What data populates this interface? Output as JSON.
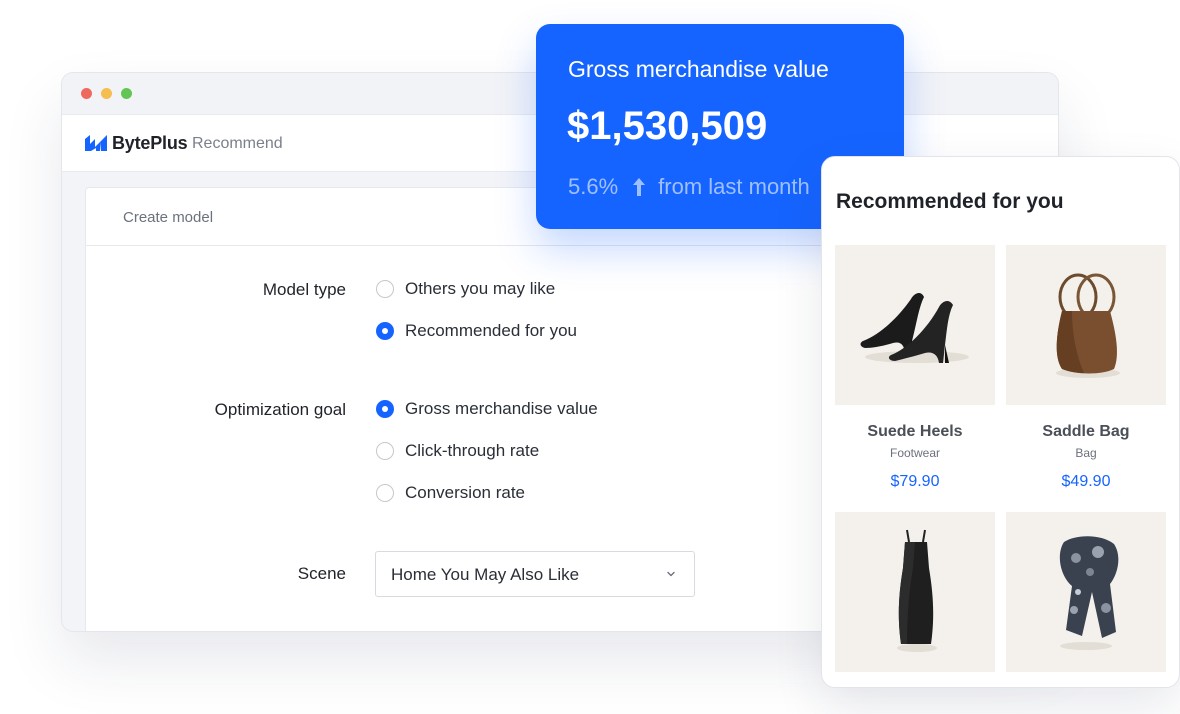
{
  "app": {
    "brand": "BytePlus",
    "product": "Recommend"
  },
  "card": {
    "title": "Create model"
  },
  "form": {
    "model_type": {
      "label": "Model type",
      "options": [
        {
          "label": "Others you may like",
          "checked": false
        },
        {
          "label": "Recommended for you",
          "checked": true
        }
      ]
    },
    "optimization_goal": {
      "label": "Optimization goal",
      "options": [
        {
          "label": "Gross merchandise value",
          "checked": true
        },
        {
          "label": "Click-through rate",
          "checked": false
        },
        {
          "label": "Conversion rate",
          "checked": false
        }
      ]
    },
    "scene": {
      "label": "Scene",
      "value": "Home You May Also Like"
    }
  },
  "gmv": {
    "title": "Gross merchandise value",
    "value": "$1,530,509",
    "change": "5.6%",
    "suffix": "from last month"
  },
  "recommendations": {
    "title": "Recommended for you",
    "products": [
      {
        "name": "Suede Heels",
        "category": "Footwear",
        "price": "$79.90",
        "image_icon": "heels-icon"
      },
      {
        "name": "Saddle Bag",
        "category": "Bag",
        "price": "$49.90",
        "image_icon": "bag-icon"
      },
      {
        "image_icon": "dress-icon"
      },
      {
        "image_icon": "scarf-icon"
      }
    ]
  },
  "colors": {
    "accent": "#1664ff",
    "accent_light": "#9ec0ff",
    "tile_bg": "#f4f1ec"
  }
}
